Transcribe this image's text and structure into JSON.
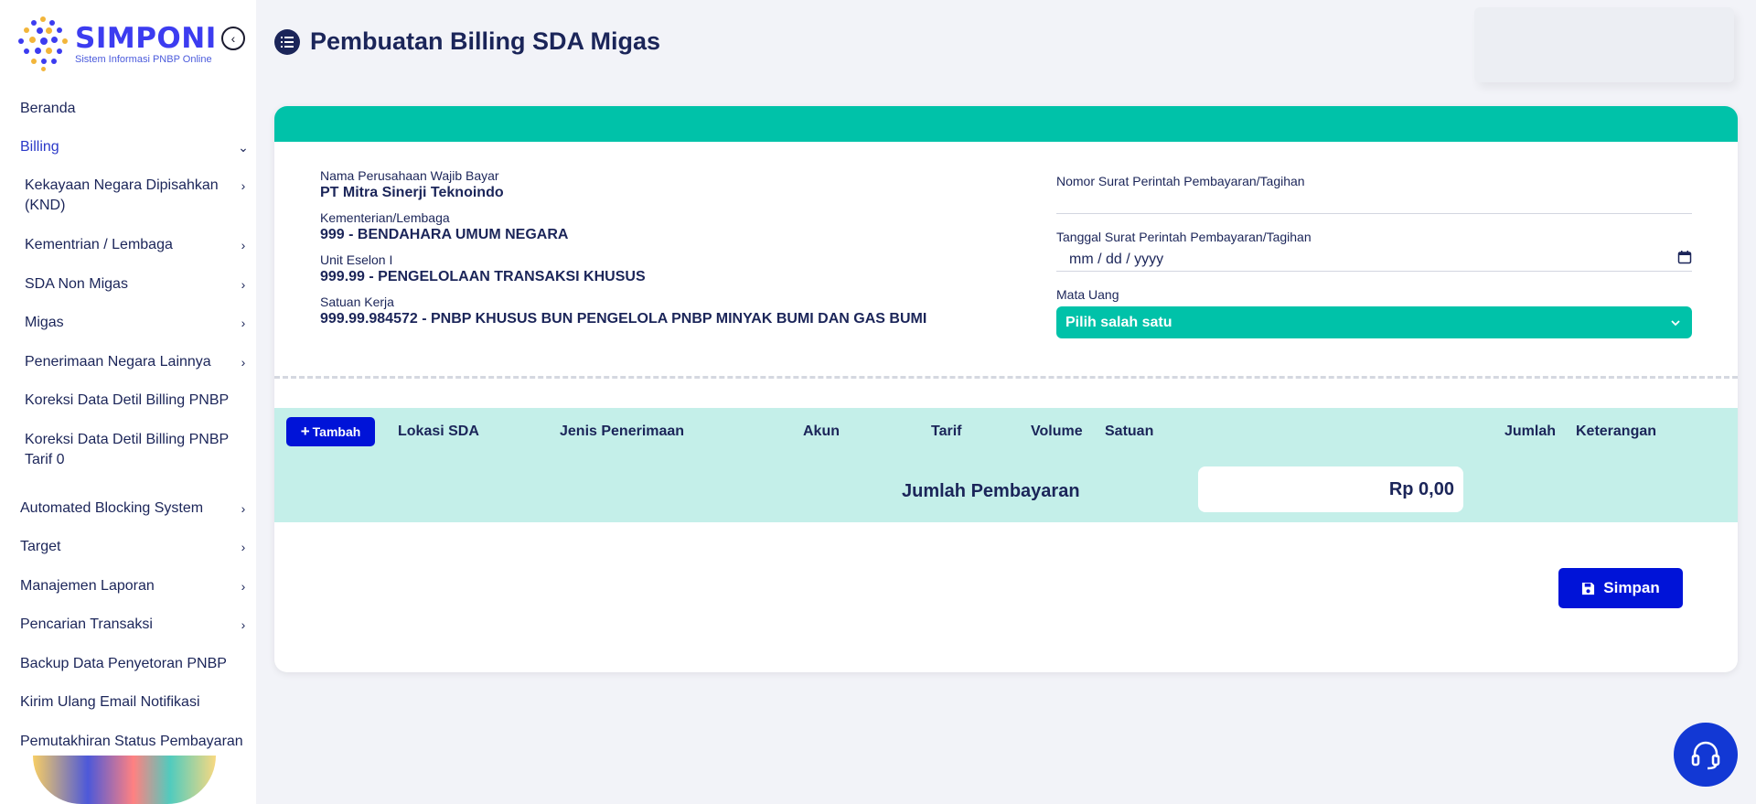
{
  "sidebar": {
    "logo_title": "SIMPONI",
    "logo_subtitle": "Sistem Informasi PNBP Online",
    "items": [
      {
        "label": "Beranda"
      },
      {
        "label": "Billing"
      },
      {
        "label": "Kekayaan Negara Dipisahkan (KND)"
      },
      {
        "label": "Kementrian / Lembaga"
      },
      {
        "label": "SDA Non Migas"
      },
      {
        "label": "Migas"
      },
      {
        "label": "Penerimaan Negara Lainnya"
      },
      {
        "label": "Koreksi Data Detil Billing PNBP"
      },
      {
        "label": "Koreksi Data Detil Billing PNBP Tarif 0"
      },
      {
        "label": "Automated Blocking System"
      },
      {
        "label": "Target"
      },
      {
        "label": "Manajemen Laporan"
      },
      {
        "label": "Pencarian Transaksi"
      },
      {
        "label": "Backup Data Penyetoran PNBP"
      },
      {
        "label": "Kirim Ulang Email Notifikasi"
      },
      {
        "label": "Pemutakhiran Status Pembayaran"
      }
    ]
  },
  "header": {
    "title": "Pembuatan Billing SDA Migas"
  },
  "info": {
    "company_label": "Nama Perusahaan Wajib Bayar",
    "company_value": "PT Mitra Sinerji Teknoindo",
    "ministry_label": "Kementerian/Lembaga",
    "ministry_value": "999 - BENDAHARA UMUM NEGARA",
    "unit_label": "Unit Eselon I",
    "unit_value": "999.99 - PENGELOLAAN TRANSAKSI KHUSUS",
    "satker_label": "Satuan Kerja",
    "satker_value": "999.99.984572 - PNBP KHUSUS BUN PENGELOLA PNBP MINYAK BUMI DAN GAS BUMI"
  },
  "form": {
    "nomor_label": "Nomor Surat Perintah Pembayaran/Tagihan",
    "nomor_value": "",
    "tanggal_label": "Tanggal Surat Perintah Pembayaran/Tagihan",
    "tanggal_placeholder": "mm / dd / yyyy",
    "currency_label": "Mata Uang",
    "currency_selected": "Pilih salah satu"
  },
  "table": {
    "add_label": "Tambah",
    "columns": [
      "Lokasi SDA",
      "Jenis Penerimaan",
      "Akun",
      "Tarif",
      "Volume",
      "Satuan",
      "Jumlah",
      "Keterangan"
    ],
    "total_label": "Jumlah Pembayaran",
    "total_value": "Rp 0,00"
  },
  "actions": {
    "save_label": "Simpan"
  },
  "colors": {
    "accent_teal": "#00c2a9",
    "primary_blue": "#0013d8",
    "navy_text": "#1b2559",
    "table_bg": "#c4efe9"
  },
  "icons": {
    "collapse": "chevron-left-circle-icon",
    "header": "list-icon",
    "calendar": "calendar-icon",
    "dropdown": "chevron-down-icon",
    "save": "floppy-disk-icon",
    "help": "headset-icon",
    "add": "plus-icon"
  }
}
